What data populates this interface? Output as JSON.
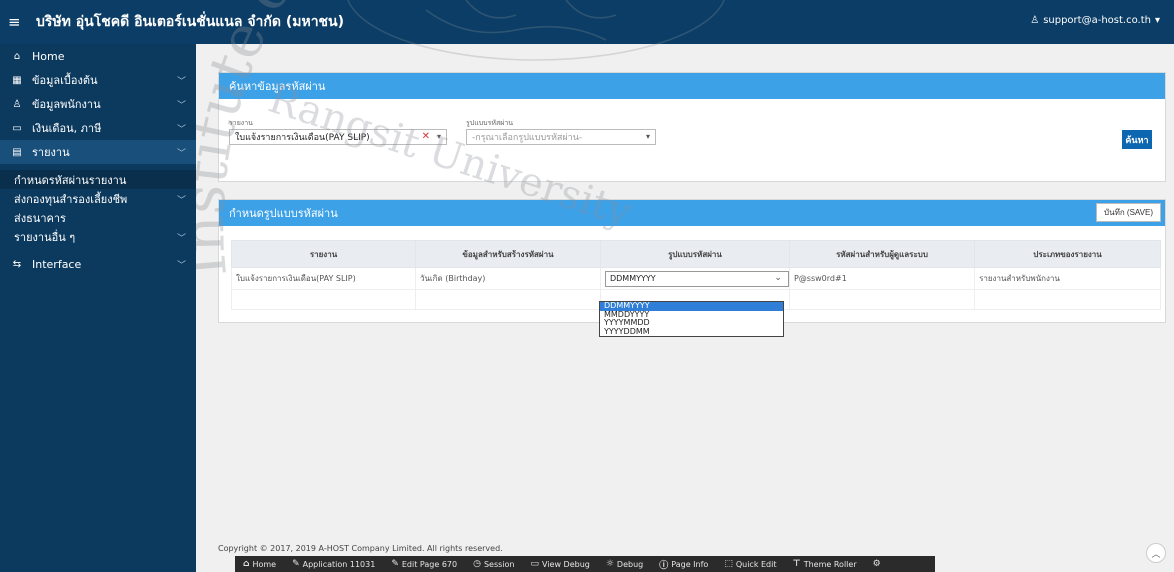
{
  "header": {
    "menu_icon": "hamburger-icon",
    "title": "บริษัท อุ่นโชคดี อินเตอร์เนชั่นแนล จำกัด (มหาชน)",
    "user": "support@a-host.co.th"
  },
  "sidebar": {
    "items": [
      {
        "label": "Home",
        "icon": "home-icon"
      },
      {
        "label": "ข้อมูลเบื้องต้น",
        "icon": "grid-icon"
      },
      {
        "label": "ข้อมูลพนักงาน",
        "icon": "person-icon"
      },
      {
        "label": "เงินเดือน, ภาษี",
        "icon": "money-icon"
      },
      {
        "label": "รายงาน",
        "icon": "report-icon"
      }
    ],
    "sub_items": [
      {
        "label": "กำหนดรหัสผ่านรายงาน"
      },
      {
        "label": "ส่งกองทุนสำรองเลี้ยงชีพ"
      },
      {
        "label": "ส่งธนาคาร"
      },
      {
        "label": "รายงานอื่น ๆ"
      }
    ],
    "interface": {
      "label": "Interface",
      "icon": "sliders-icon"
    }
  },
  "search_card": {
    "title": "ค้นหาข้อมูลรหัสผ่าน",
    "report_label": "รายงาน",
    "report_value": "ใบแจ้งรายการเงินเดือน(PAY SLIP)",
    "format_label": "รูปแบบรหัสผ่าน",
    "format_placeholder": "-กรุณาเลือกรูปแบบรหัสผ่าน-",
    "search_button": "ค้นหา"
  },
  "format_card": {
    "title": "กำหนดรูปแบบรหัสผ่าน",
    "save_button": "บันทึก (SAVE)",
    "columns": [
      "รายงาน",
      "ข้อมูลสำหรับสร้างรหัสผ่าน",
      "รูปแบบรหัสผ่าน",
      "รหัสผ่านสำหรับผู้ดูแลระบบ",
      "ประเภทของรายงาน"
    ],
    "row": {
      "report": "ใบแจ้งรายการเงินเดือน(PAY SLIP)",
      "source": "วันเกิด (Birthday)",
      "format": "DDMMYYYY",
      "admin_password": "P@ssw0rd#1",
      "report_type": "รายงานสำหรับพนักงาน"
    },
    "dropdown_options": [
      "DDMMYYYY",
      "MMDDYYYY",
      "YYYYMMDD",
      "YYYYDDMM"
    ],
    "dropdown_selected": "DDMMYYYY"
  },
  "footer": {
    "copyright": "Copyright © 2017, 2019 A-HOST Company Limited. All rights reserved."
  },
  "dev_toolbar": [
    {
      "label": "Home",
      "icon": "home-icon"
    },
    {
      "label": "Application 11031",
      "icon": "edit-icon"
    },
    {
      "label": "Edit Page 670",
      "icon": "edit-icon"
    },
    {
      "label": "Session",
      "icon": "clock-icon"
    },
    {
      "label": "View Debug",
      "icon": "window-icon"
    },
    {
      "label": "Debug",
      "icon": "bug-icon"
    },
    {
      "label": "Page Info",
      "icon": "info-icon"
    },
    {
      "label": "Quick Edit",
      "icon": "cursor-icon"
    },
    {
      "label": "Theme Roller",
      "icon": "paint-roller-icon"
    }
  ],
  "watermark": {
    "line1": "Rangsit University",
    "line2": "Institute of Technology"
  }
}
